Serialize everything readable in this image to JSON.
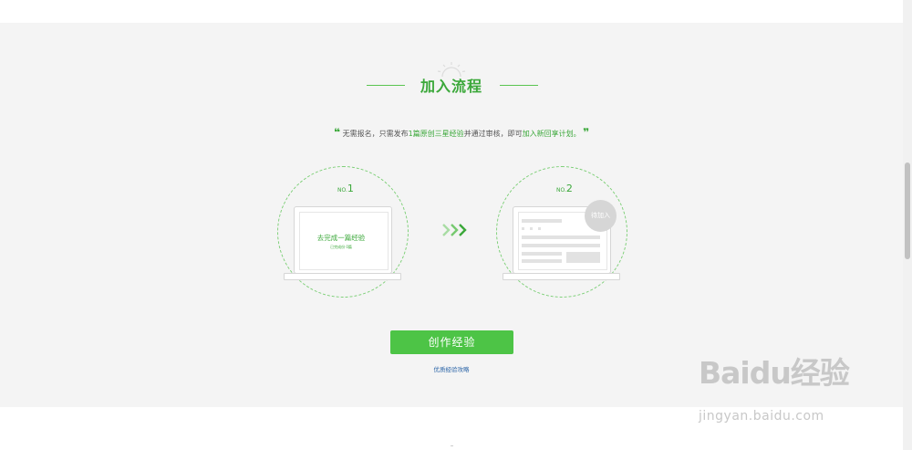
{
  "section": {
    "title": "加入流程",
    "quote": {
      "open_mark": "❝",
      "close_mark": "❞",
      "part1": "无需报名，只需发布",
      "highlight1": "1篇原创三星经验",
      "part2": "并通过审核，即可",
      "highlight2": "加入新回享计划。"
    },
    "steps": [
      {
        "no_prefix": "NO.",
        "no_num": "1",
        "task": "去完成一篇经验",
        "task_sub": "已完成份    0篇"
      },
      {
        "no_prefix": "NO.",
        "no_num": "2",
        "badge": "待加入"
      }
    ],
    "create_button": "创作经验",
    "guide_link": "优质经验攻略"
  },
  "watermark": {
    "brand": "Baidu经验",
    "url": "jingyan.baidu.com"
  },
  "colors": {
    "accent": "#4dc446",
    "accent_text": "#3ba83a",
    "link": "#2d66a8",
    "background": "#f4f4f4"
  }
}
